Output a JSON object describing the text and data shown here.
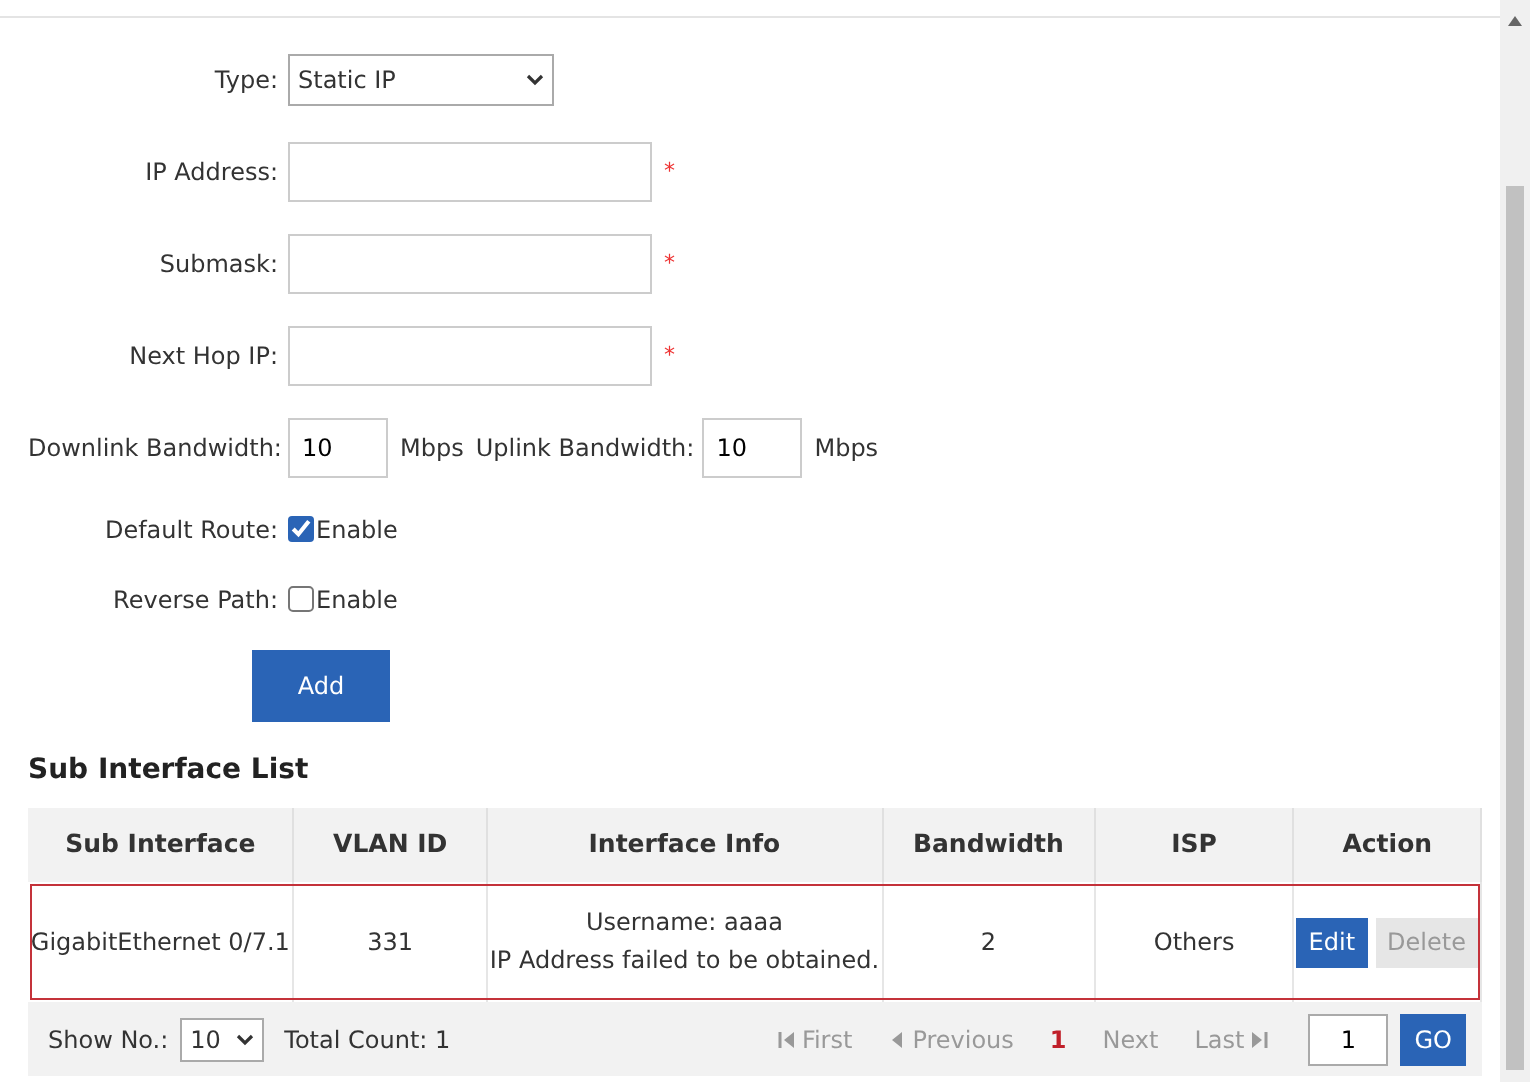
{
  "form": {
    "fields": [
      {
        "kind": "select",
        "label": "Type:",
        "value": "Static IP"
      },
      {
        "kind": "text",
        "label": "IP Address:",
        "required_mark": "*"
      },
      {
        "kind": "text",
        "label": "Submask:",
        "required_mark": "*"
      },
      {
        "kind": "text",
        "label": "Next Hop IP:",
        "required_mark": "*"
      },
      {
        "kind": "bandwidth",
        "label": "Downlink Bandwidth:",
        "value": "10",
        "unit": "Mbps",
        "label2": "Uplink Bandwidth:",
        "value2": "10",
        "unit2": "Mbps"
      },
      {
        "kind": "checkbox",
        "label": "Default Route:",
        "option": "Enable",
        "checked": true
      },
      {
        "kind": "checkbox",
        "label": "Reverse Path:",
        "option": "Enable",
        "checked": false
      }
    ],
    "submit": "Add"
  },
  "list": {
    "title": "Sub Interface List",
    "columns": [
      "Sub Interface",
      "VLAN ID",
      "Interface Info",
      "Bandwidth",
      "ISP",
      "Action"
    ],
    "rows": [
      {
        "highlighted": true,
        "sub_interface": "GigabitEthernet 0/7.1",
        "vlan_id": "331",
        "info": [
          "Username: aaaa",
          "IP Address failed to be obtained."
        ],
        "bandwidth": "2",
        "isp": "Others",
        "actions": [
          {
            "label": "Edit",
            "disabled": false
          },
          {
            "label": "Delete",
            "disabled": true
          }
        ]
      }
    ],
    "pager": {
      "show_label": "Show No.:",
      "page_size": "10",
      "total": "Total Count: 1",
      "nav": [
        {
          "kind": "first",
          "label": "First",
          "disabled": true
        },
        {
          "kind": "prev",
          "label": "Previous",
          "disabled": true
        },
        {
          "kind": "page",
          "label": "1",
          "selected": true
        },
        {
          "kind": "next",
          "label": "Next",
          "disabled": true
        },
        {
          "kind": "last",
          "label": "Last",
          "disabled": true
        }
      ],
      "page_value": "1",
      "go": "GO"
    }
  }
}
